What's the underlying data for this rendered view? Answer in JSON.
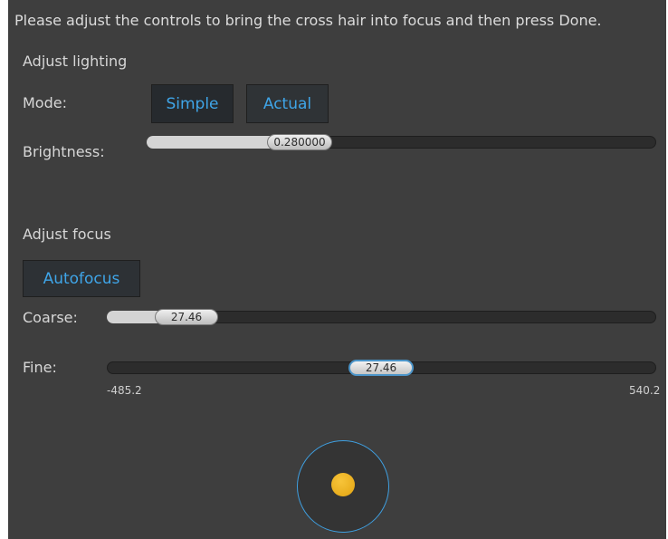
{
  "instruction": "Please adjust the controls to bring the cross hair into focus and then press Done.",
  "lighting": {
    "heading": "Adjust lighting",
    "mode_label": "Mode:",
    "modes": [
      "Simple",
      "Actual"
    ],
    "selected_mode": "Simple",
    "brightness_label": "Brightness:",
    "brightness_value": "0.280000",
    "brightness_level": 0.28
  },
  "focus": {
    "heading": "Adjust focus",
    "autofocus_label": "Autofocus",
    "coarse_label": "Coarse:",
    "coarse_value": "27.46",
    "fine_label": "Fine:",
    "fine_value": "27.46",
    "fine_min": "-485.2",
    "fine_max": "540.2"
  },
  "colors": {
    "accent": "#3fa5e8",
    "background": "#3e3e3e",
    "crosshair_dot": "#f0b324"
  },
  "icons": {
    "focus_target": "crosshair-target-icon"
  }
}
